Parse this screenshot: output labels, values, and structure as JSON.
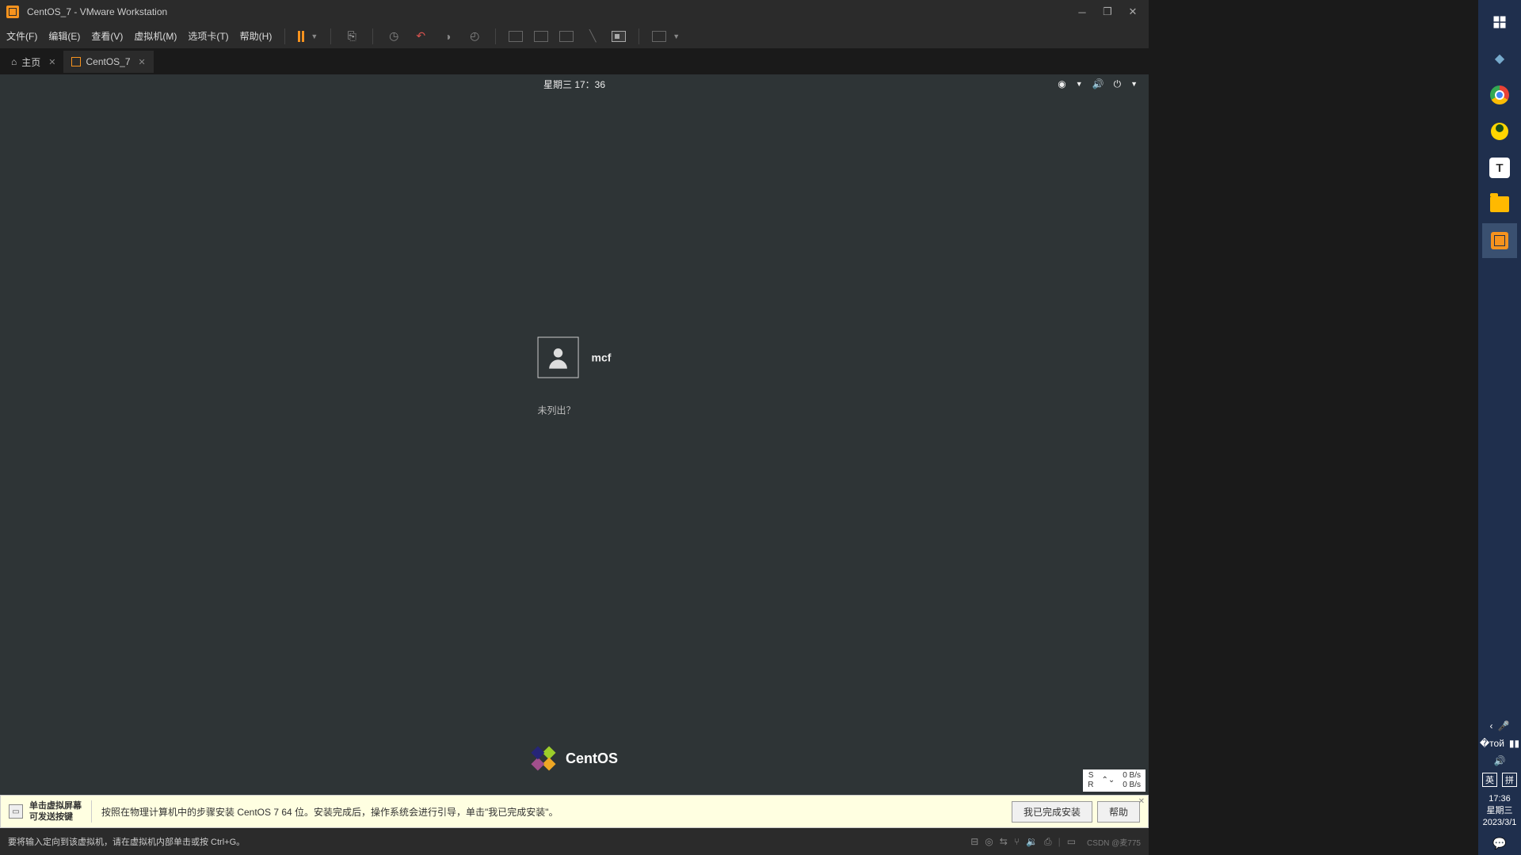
{
  "titlebar": {
    "title": "CentOS_7 - VMware Workstation"
  },
  "menubar": {
    "file": "文件(F)",
    "edit": "编辑(E)",
    "view": "查看(V)",
    "vm": "虚拟机(M)",
    "tabs": "选项卡(T)",
    "help": "帮助(H)"
  },
  "tabs": {
    "home": "主页",
    "vm": "CentOS_7"
  },
  "gnome": {
    "clock": "星期三 17：36",
    "user": "mcf",
    "not_listed": "未列出？",
    "brand": "CentOS"
  },
  "netwidget": {
    "s": "S",
    "r": "R",
    "up": "0 B/s",
    "down": "0 B/s"
  },
  "infobar": {
    "bold_l1": "单击虚拟屏幕",
    "bold_l2": "可发送按键",
    "msg": "按照在物理计算机中的步骤安装 CentOS 7 64 位。安装完成后，操作系统会进行引导，单击\"我已完成安装\"。",
    "done": "我已完成安装",
    "help": "帮助"
  },
  "statusbar": {
    "msg": "要将输入定向到该虚拟机，请在虚拟机内部单击或按 Ctrl+G。",
    "watermark": "CSDN @麦775"
  },
  "win": {
    "time": "17:36",
    "day": "星期三",
    "date": "2023/3/1",
    "ime1": "英",
    "ime2": "拼"
  }
}
